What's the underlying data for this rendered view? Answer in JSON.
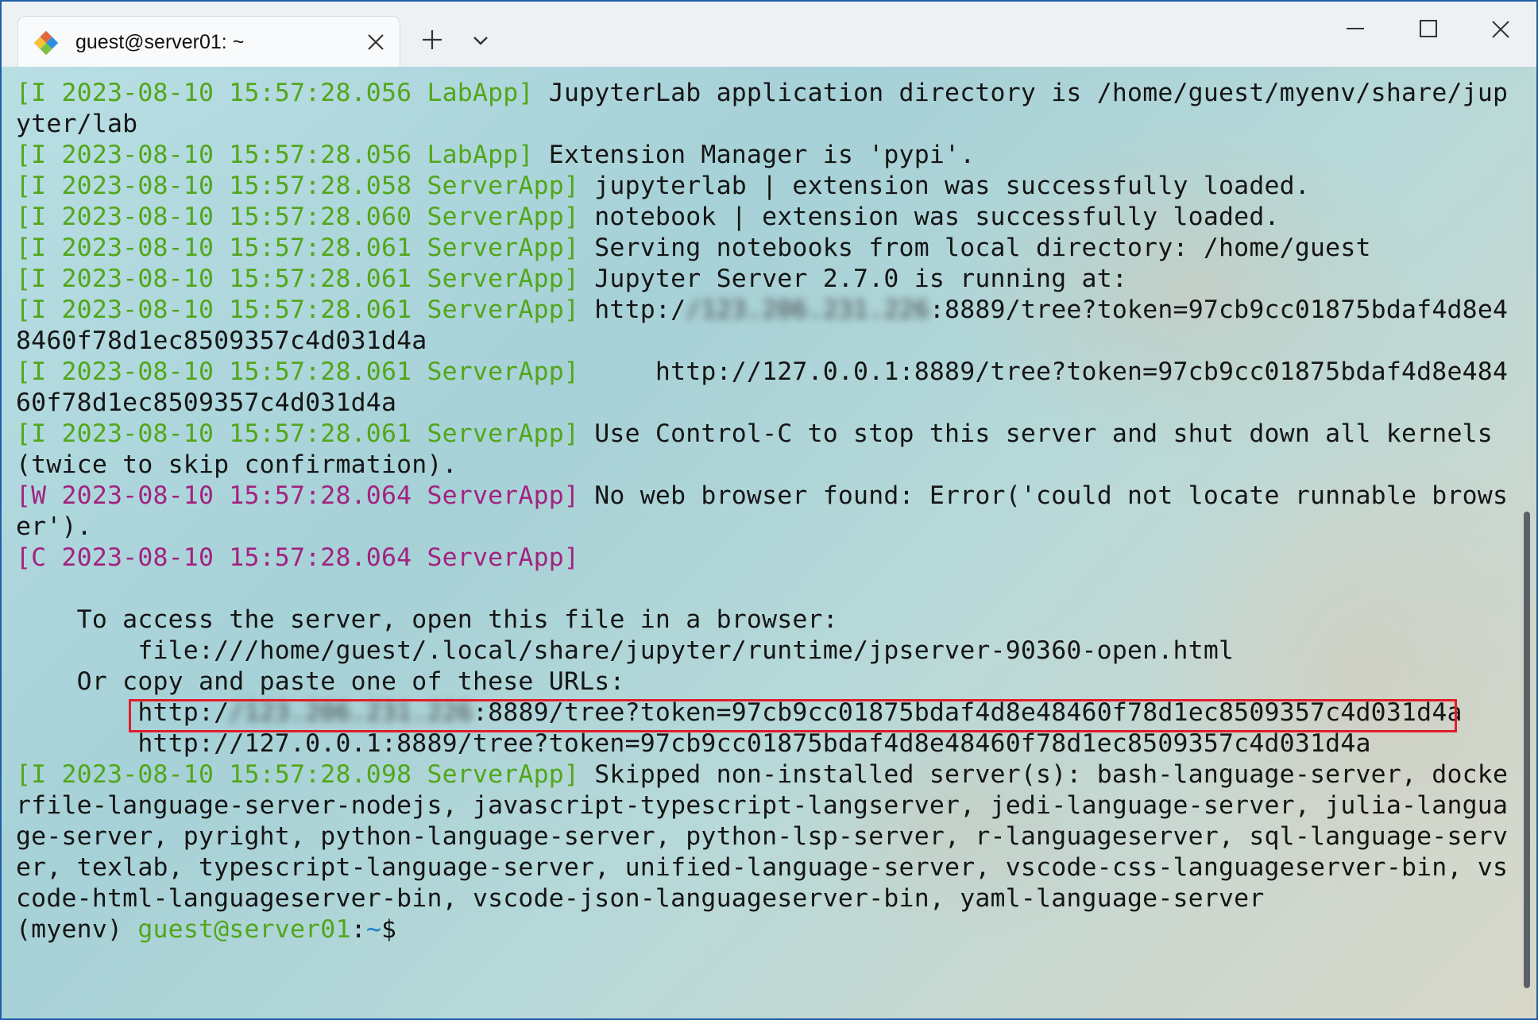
{
  "window": {
    "tab_title": "guest@server01: ~",
    "icons": {
      "tab_icon": "terminal-app-icon",
      "tab_close": "close-icon",
      "new_tab": "plus-icon",
      "dropdown": "chevron-down-icon",
      "minimize": "minimize-icon",
      "maximize": "maximize-icon",
      "close": "close-icon"
    }
  },
  "colors": {
    "info_prefix": "#52a61a",
    "warn_prefix": "#a2227f",
    "prompt_user": "#52a61a",
    "prompt_path": "#1a7fcb",
    "highlight_box": "#e11d2a"
  },
  "terminal": {
    "lines": [
      [
        {
          "c": "g",
          "t": "[I 2023-08-10 15:57:28.056 LabApp]"
        },
        {
          "c": "t",
          "t": " JupyterLab application directory is /home/guest/myenv/share/jup"
        }
      ],
      [
        {
          "c": "t",
          "t": "yter/lab"
        }
      ],
      [
        {
          "c": "g",
          "t": "[I 2023-08-10 15:57:28.056 LabApp]"
        },
        {
          "c": "t",
          "t": " Extension Manager is 'pypi'."
        }
      ],
      [
        {
          "c": "g",
          "t": "[I 2023-08-10 15:57:28.058 ServerApp]"
        },
        {
          "c": "t",
          "t": " jupyterlab | extension was successfully loaded."
        }
      ],
      [
        {
          "c": "g",
          "t": "[I 2023-08-10 15:57:28.060 ServerApp]"
        },
        {
          "c": "t",
          "t": " notebook | extension was successfully loaded."
        }
      ],
      [
        {
          "c": "g",
          "t": "[I 2023-08-10 15:57:28.061 ServerApp]"
        },
        {
          "c": "t",
          "t": " Serving notebooks from local directory: /home/guest"
        }
      ],
      [
        {
          "c": "g",
          "t": "[I 2023-08-10 15:57:28.061 ServerApp]"
        },
        {
          "c": "t",
          "t": " Jupyter Server 2.7.0 is running at:"
        }
      ],
      [
        {
          "c": "g",
          "t": "[I 2023-08-10 15:57:28.061 ServerApp]"
        },
        {
          "c": "t",
          "t": " http:/"
        },
        {
          "c": "blur",
          "t": "/123.206.231.226"
        },
        {
          "c": "t",
          "t": ":8889/tree?token=97cb9cc01875bdaf4d8e4"
        }
      ],
      [
        {
          "c": "t",
          "t": "8460f78d1ec8509357c4d031d4a"
        }
      ],
      [
        {
          "c": "g",
          "t": "[I 2023-08-10 15:57:28.061 ServerApp]"
        },
        {
          "c": "t",
          "t": "     http://127.0.0.1:8889/tree?token=97cb9cc01875bdaf4d8e484"
        }
      ],
      [
        {
          "c": "t",
          "t": "60f78d1ec8509357c4d031d4a"
        }
      ],
      [
        {
          "c": "g",
          "t": "[I 2023-08-10 15:57:28.061 ServerApp]"
        },
        {
          "c": "t",
          "t": " Use Control-C to stop this server and shut down all kernels"
        }
      ],
      [
        {
          "c": "t",
          "t": "(twice to skip confirmation)."
        }
      ],
      [
        {
          "c": "m",
          "t": "[W 2023-08-10 15:57:28.064 ServerApp]"
        },
        {
          "c": "t",
          "t": " No web browser found: Error('could not locate runnable brows"
        }
      ],
      [
        {
          "c": "t",
          "t": "er')."
        }
      ],
      [
        {
          "c": "m",
          "t": "[C 2023-08-10 15:57:28.064 ServerApp]"
        }
      ],
      [
        {
          "c": "t",
          "t": ""
        }
      ],
      [
        {
          "c": "t",
          "t": "    To access the server, open this file in a browser:"
        }
      ],
      [
        {
          "c": "t",
          "t": "        file:///home/guest/.local/share/jupyter/runtime/jpserver-90360-open.html"
        }
      ],
      [
        {
          "c": "t",
          "t": "    Or copy and paste one of these URLs:"
        }
      ],
      [
        {
          "c": "t",
          "t": "        http:/"
        },
        {
          "c": "blur",
          "t": "/123.206.231.226"
        },
        {
          "c": "t",
          "t": ":8889/tree?token=97cb9cc01875bdaf4d8e48460f78d1ec8509357c4d031d4a"
        }
      ],
      [
        {
          "c": "t",
          "t": "        http://127.0.0.1:8889/tree?token=97cb9cc01875bdaf4d8e48460f78d1ec8509357c4d031d4a"
        }
      ],
      [
        {
          "c": "g",
          "t": "[I 2023-08-10 15:57:28.098 ServerApp]"
        },
        {
          "c": "t",
          "t": " Skipped non-installed server(s): bash-language-server, docke"
        }
      ],
      [
        {
          "c": "t",
          "t": "rfile-language-server-nodejs, javascript-typescript-langserver, jedi-language-server, julia-langua"
        }
      ],
      [
        {
          "c": "t",
          "t": "ge-server, pyright, python-language-server, python-lsp-server, r-languageserver, sql-language-serv"
        }
      ],
      [
        {
          "c": "t",
          "t": "er, texlab, typescript-language-server, unified-language-server, vscode-css-languageserver-bin, vs"
        }
      ],
      [
        {
          "c": "t",
          "t": "code-html-languageserver-bin, vscode-json-languageserver-bin, yaml-language-server"
        }
      ],
      [
        {
          "c": "t",
          "t": "(myenv) "
        },
        {
          "c": "g",
          "t": "guest@server01"
        },
        {
          "c": "t",
          "t": ":"
        },
        {
          "c": "u",
          "t": "~"
        },
        {
          "c": "t",
          "t": "$"
        }
      ]
    ]
  }
}
